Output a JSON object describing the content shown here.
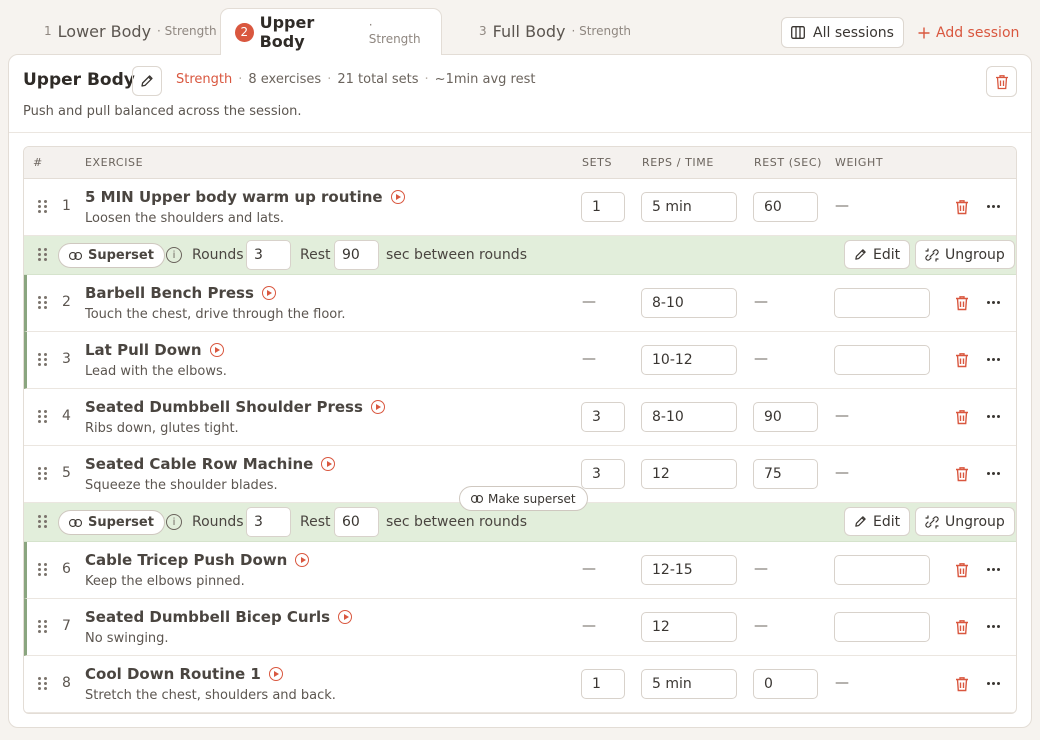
{
  "tabs": [
    {
      "num": "1",
      "name": "Lower Body",
      "kind": "· Strength"
    },
    {
      "num": "2",
      "name": "Upper Body",
      "kind": "· Strength"
    },
    {
      "num": "3",
      "name": "Full Body",
      "kind": "· Strength"
    }
  ],
  "toolbar": {
    "all_sessions": "All sessions",
    "add_session": "Add session"
  },
  "session": {
    "title": "Upper Body",
    "category": "Strength",
    "exercises": "8 exercises",
    "total_sets": "21 total sets",
    "avg_rest": "~1min avg rest",
    "sep": "·",
    "description": "Push and pull balanced across the session."
  },
  "columns": {
    "num": "#",
    "exercise": "EXERCISE",
    "sets": "SETS",
    "reps": "REPS / TIME",
    "rest": "REST (SEC)",
    "weight": "WEIGHT"
  },
  "dash": "—",
  "rows": [
    {
      "n": "1",
      "name": "5 MIN Upper body warm up routine",
      "note": "Loosen the shoulders and lats.",
      "sets": "1",
      "reps": "5 min",
      "rest": "60",
      "weight": ""
    },
    {
      "n": "2",
      "name": "Barbell Bench Press",
      "note": "Touch the chest, drive through the floor.",
      "sets": "",
      "reps": "8-10",
      "rest": "",
      "weight": ""
    },
    {
      "n": "3",
      "name": "Lat Pull Down",
      "note": "Lead with the elbows.",
      "sets": "",
      "reps": "10-12",
      "rest": "",
      "weight": ""
    },
    {
      "n": "4",
      "name": "Seated Dumbbell Shoulder Press",
      "note": "Ribs down, glutes tight.",
      "sets": "3",
      "reps": "8-10",
      "rest": "90",
      "weight": ""
    },
    {
      "n": "5",
      "name": "Seated Cable Row Machine",
      "note": "Squeeze the shoulder blades.",
      "sets": "3",
      "reps": "12",
      "rest": "75",
      "weight": ""
    },
    {
      "n": "6",
      "name": "Cable Tricep Push Down",
      "note": "Keep the elbows pinned.",
      "sets": "",
      "reps": "12-15",
      "rest": "",
      "weight": ""
    },
    {
      "n": "7",
      "name": "Seated Dumbbell Bicep Curls",
      "note": "No swinging.",
      "sets": "",
      "reps": "12",
      "rest": "",
      "weight": ""
    },
    {
      "n": "8",
      "name": "Cool Down Routine 1",
      "note": "Stretch the chest, shoulders and back.",
      "sets": "1",
      "reps": "5 min",
      "rest": "0",
      "weight": ""
    }
  ],
  "supersets": [
    {
      "label": "Superset",
      "rounds_label": "Rounds",
      "rounds": "3",
      "rest_label": "Rest",
      "rest": "90",
      "suffix": "sec between rounds",
      "edit": "Edit",
      "ungroup": "Ungroup"
    },
    {
      "label": "Superset",
      "rounds_label": "Rounds",
      "rounds": "3",
      "rest_label": "Rest",
      "rest": "60",
      "suffix": "sec between rounds",
      "edit": "Edit",
      "ungroup": "Ungroup"
    }
  ],
  "make_superset": "Make superset",
  "colors": {
    "accent": "#d9573f",
    "superset_bg": "#e2eedb",
    "group_bar": "#8aa57f"
  }
}
